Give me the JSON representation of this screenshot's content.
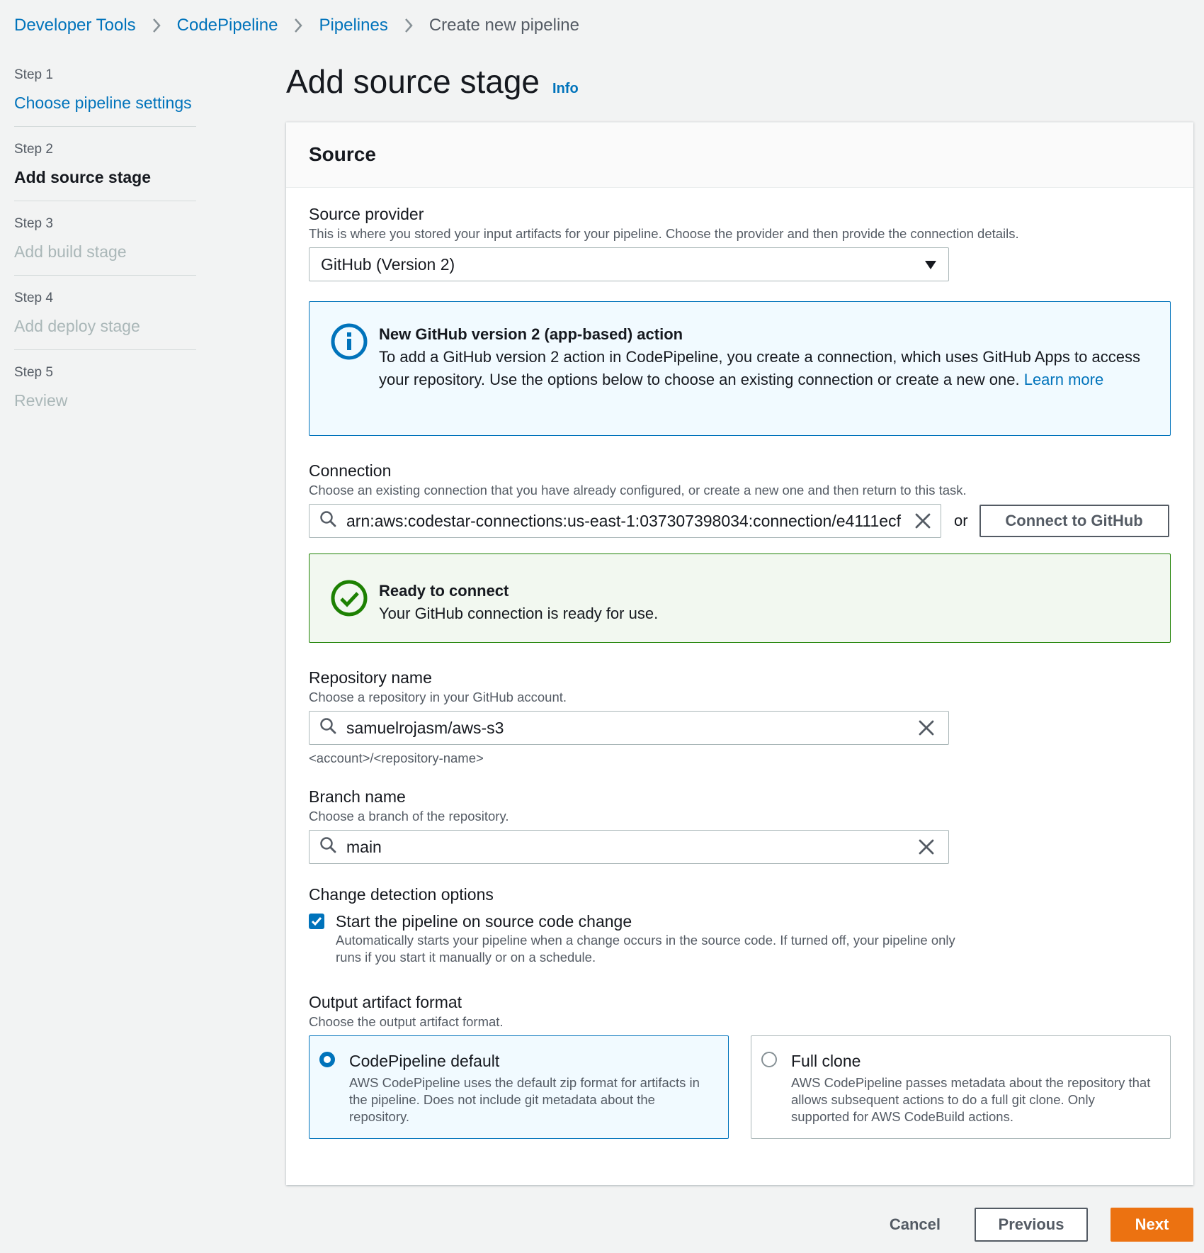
{
  "breadcrumb": {
    "items": [
      "Developer Tools",
      "CodePipeline",
      "Pipelines"
    ],
    "current": "Create new pipeline"
  },
  "steps": [
    {
      "num": "Step 1",
      "title": "Choose pipeline settings",
      "state": "done"
    },
    {
      "num": "Step 2",
      "title": "Add source stage",
      "state": "active"
    },
    {
      "num": "Step 3",
      "title": "Add build stage",
      "state": "disabled"
    },
    {
      "num": "Step 4",
      "title": "Add deploy stage",
      "state": "disabled"
    },
    {
      "num": "Step 5",
      "title": "Review",
      "state": "disabled"
    }
  ],
  "page": {
    "title": "Add source stage",
    "info_link": "Info"
  },
  "source": {
    "header": "Source",
    "provider": {
      "label": "Source provider",
      "description": "This is where you stored your input artifacts for your pipeline. Choose the provider and then provide the connection details.",
      "value": "GitHub (Version 2)"
    },
    "info_alert": {
      "title": "New GitHub version 2 (app-based) action",
      "text": "To add a GitHub version 2 action in CodePipeline, you create a connection, which uses GitHub Apps to access your repository. Use the options below to choose an existing connection or create a new one.",
      "link": "Learn more"
    },
    "connection": {
      "label": "Connection",
      "description": "Choose an existing connection that you have already configured, or create a new one and then return to this task.",
      "value": "arn:aws:codestar-connections:us-east-1:037307398034:connection/e4111ecf",
      "or": "or",
      "connect_button": "Connect to GitHub"
    },
    "success_alert": {
      "title": "Ready to connect",
      "text": "Your GitHub connection is ready for use."
    },
    "repository": {
      "label": "Repository name",
      "description": "Choose a repository in your GitHub account.",
      "value": "samuelrojasm/aws-s3",
      "hint": "<account>/<repository-name>"
    },
    "branch": {
      "label": "Branch name",
      "description": "Choose a branch of the repository.",
      "value": "main"
    },
    "change_detection": {
      "label": "Change detection options",
      "checkbox_label": "Start the pipeline on source code change",
      "checkbox_desc": "Automatically starts your pipeline when a change occurs in the source code. If turned off, your pipeline only runs if you start it manually or on a schedule.",
      "checked": true
    },
    "output_format": {
      "label": "Output artifact format",
      "description": "Choose the output artifact format.",
      "options": [
        {
          "title": "CodePipeline default",
          "desc": "AWS CodePipeline uses the default zip format for artifacts in the pipeline. Does not include git metadata about the repository.",
          "selected": true
        },
        {
          "title": "Full clone",
          "desc": "AWS CodePipeline passes metadata about the repository that allows subsequent actions to do a full git clone. Only supported for AWS CodeBuild actions.",
          "selected": false
        }
      ]
    }
  },
  "footer": {
    "cancel": "Cancel",
    "previous": "Previous",
    "next": "Next"
  },
  "colors": {
    "link": "#0073bb",
    "primary": "#ec7211",
    "success": "#1d8102",
    "background": "#f2f3f3"
  }
}
